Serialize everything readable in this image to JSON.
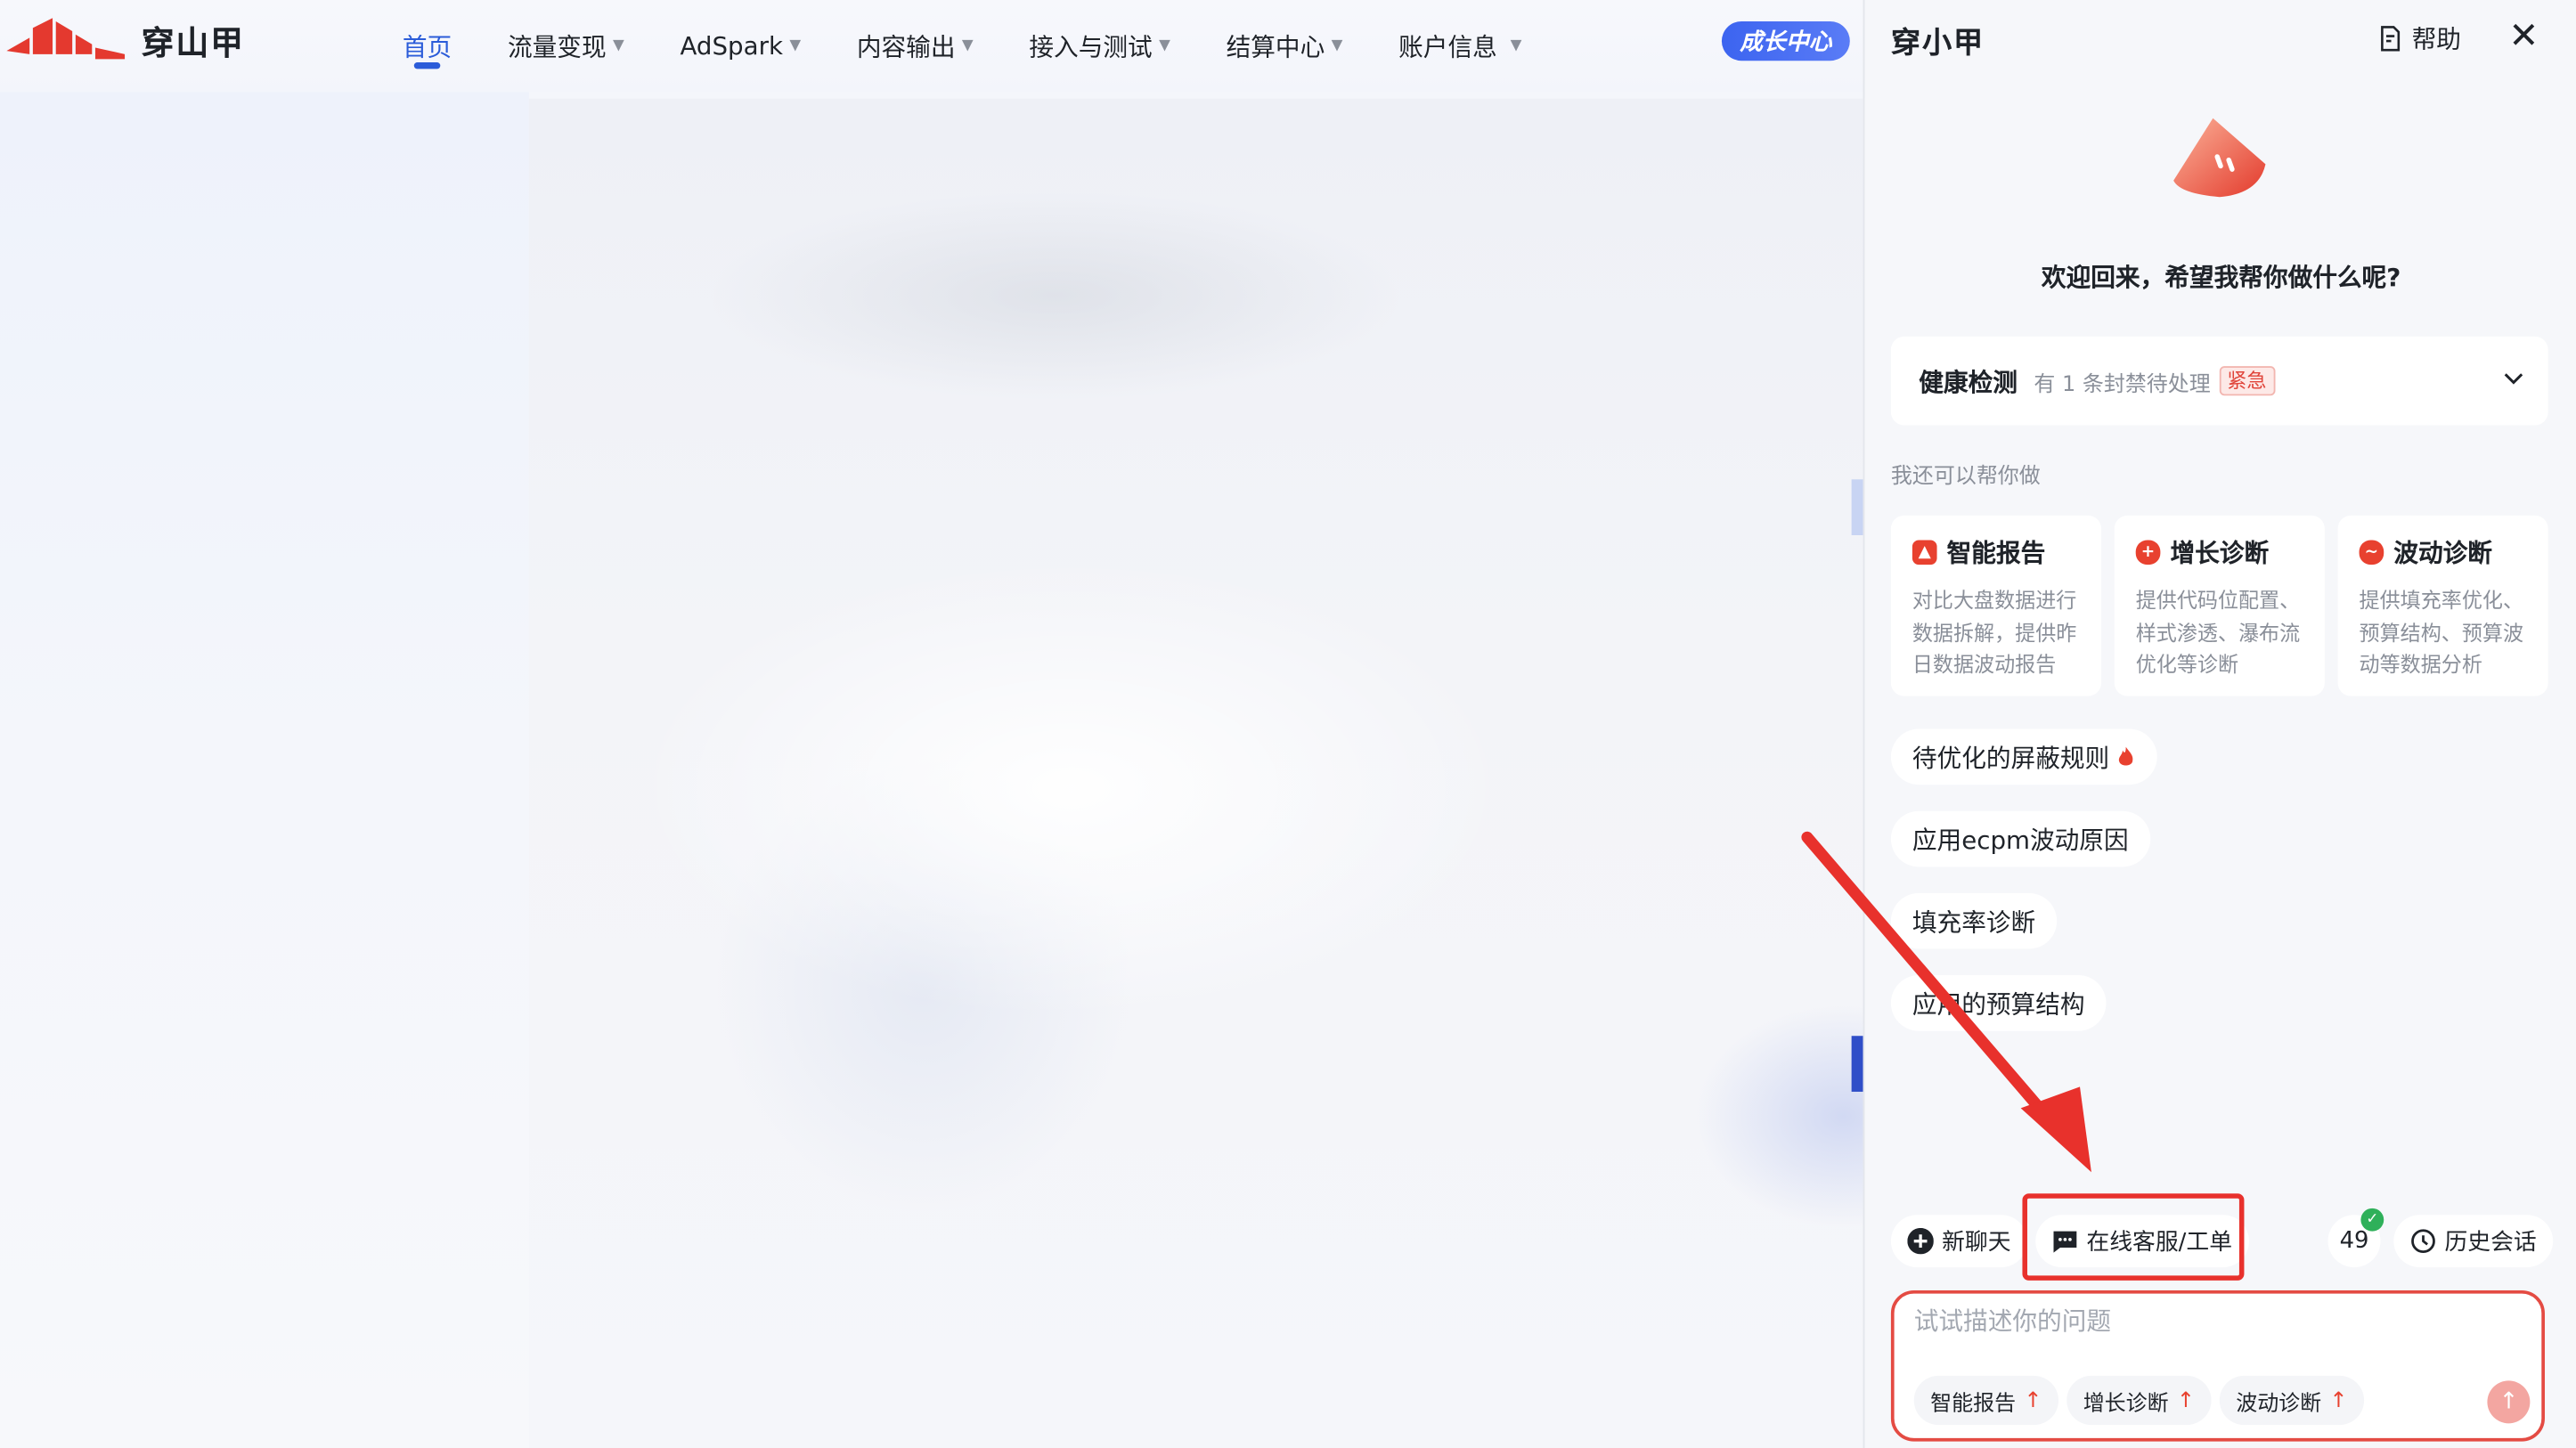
{
  "brand": {
    "name": "穿山甲",
    "logo_color": "#e4392f"
  },
  "nav": {
    "items": [
      {
        "label": "首页",
        "active": true,
        "dropdown": false
      },
      {
        "label": "流量变现",
        "active": false,
        "dropdown": true
      },
      {
        "label": "AdSpark",
        "active": false,
        "dropdown": true
      },
      {
        "label": "内容输出",
        "active": false,
        "dropdown": true
      },
      {
        "label": "接入与测试",
        "active": false,
        "dropdown": true
      },
      {
        "label": "结算中心",
        "active": false,
        "dropdown": true
      },
      {
        "label": "账户信息",
        "active": false,
        "dropdown": true
      }
    ],
    "growth_button": "成长中心",
    "accent": "#2b5cd9"
  },
  "assistant": {
    "title": "穿小甲",
    "help_label": "帮助",
    "welcome": "欢迎回来，希望我帮你做什么呢?",
    "health": {
      "title": "健康检测",
      "summary": "有 1 条封禁待处理",
      "badge": "紧急"
    },
    "can_help_label": "我还可以帮你做",
    "cards": [
      {
        "icon": "report-icon",
        "title": "智能报告",
        "desc": "对比大盘数据进行数据拆解，提供昨日数据波动报告"
      },
      {
        "icon": "growth-diagnosis-icon",
        "title": "增长诊断",
        "desc": "提供代码位配置、样式渗透、瀑布流优化等诊断"
      },
      {
        "icon": "fluctuation-icon",
        "title": "波动诊断",
        "desc": "提供填充率优化、预算结构、预算波动等数据分析"
      }
    ],
    "suggestions": [
      {
        "label": "待优化的屏蔽规则",
        "hot": true
      },
      {
        "label": "应用ecpm波动原因",
        "hot": false
      },
      {
        "label": "填充率诊断",
        "hot": false
      },
      {
        "label": "应用的预算结构",
        "hot": false
      }
    ],
    "toolbar": {
      "new_chat": "新聊天",
      "online_service": "在线客服/工单",
      "count": "49",
      "history": "历史会话"
    },
    "input": {
      "placeholder": "试试描述你的问题",
      "value": "",
      "quick_actions": [
        "智能报告",
        "增长诊断",
        "波动诊断"
      ]
    },
    "accent": "#e8412f"
  }
}
